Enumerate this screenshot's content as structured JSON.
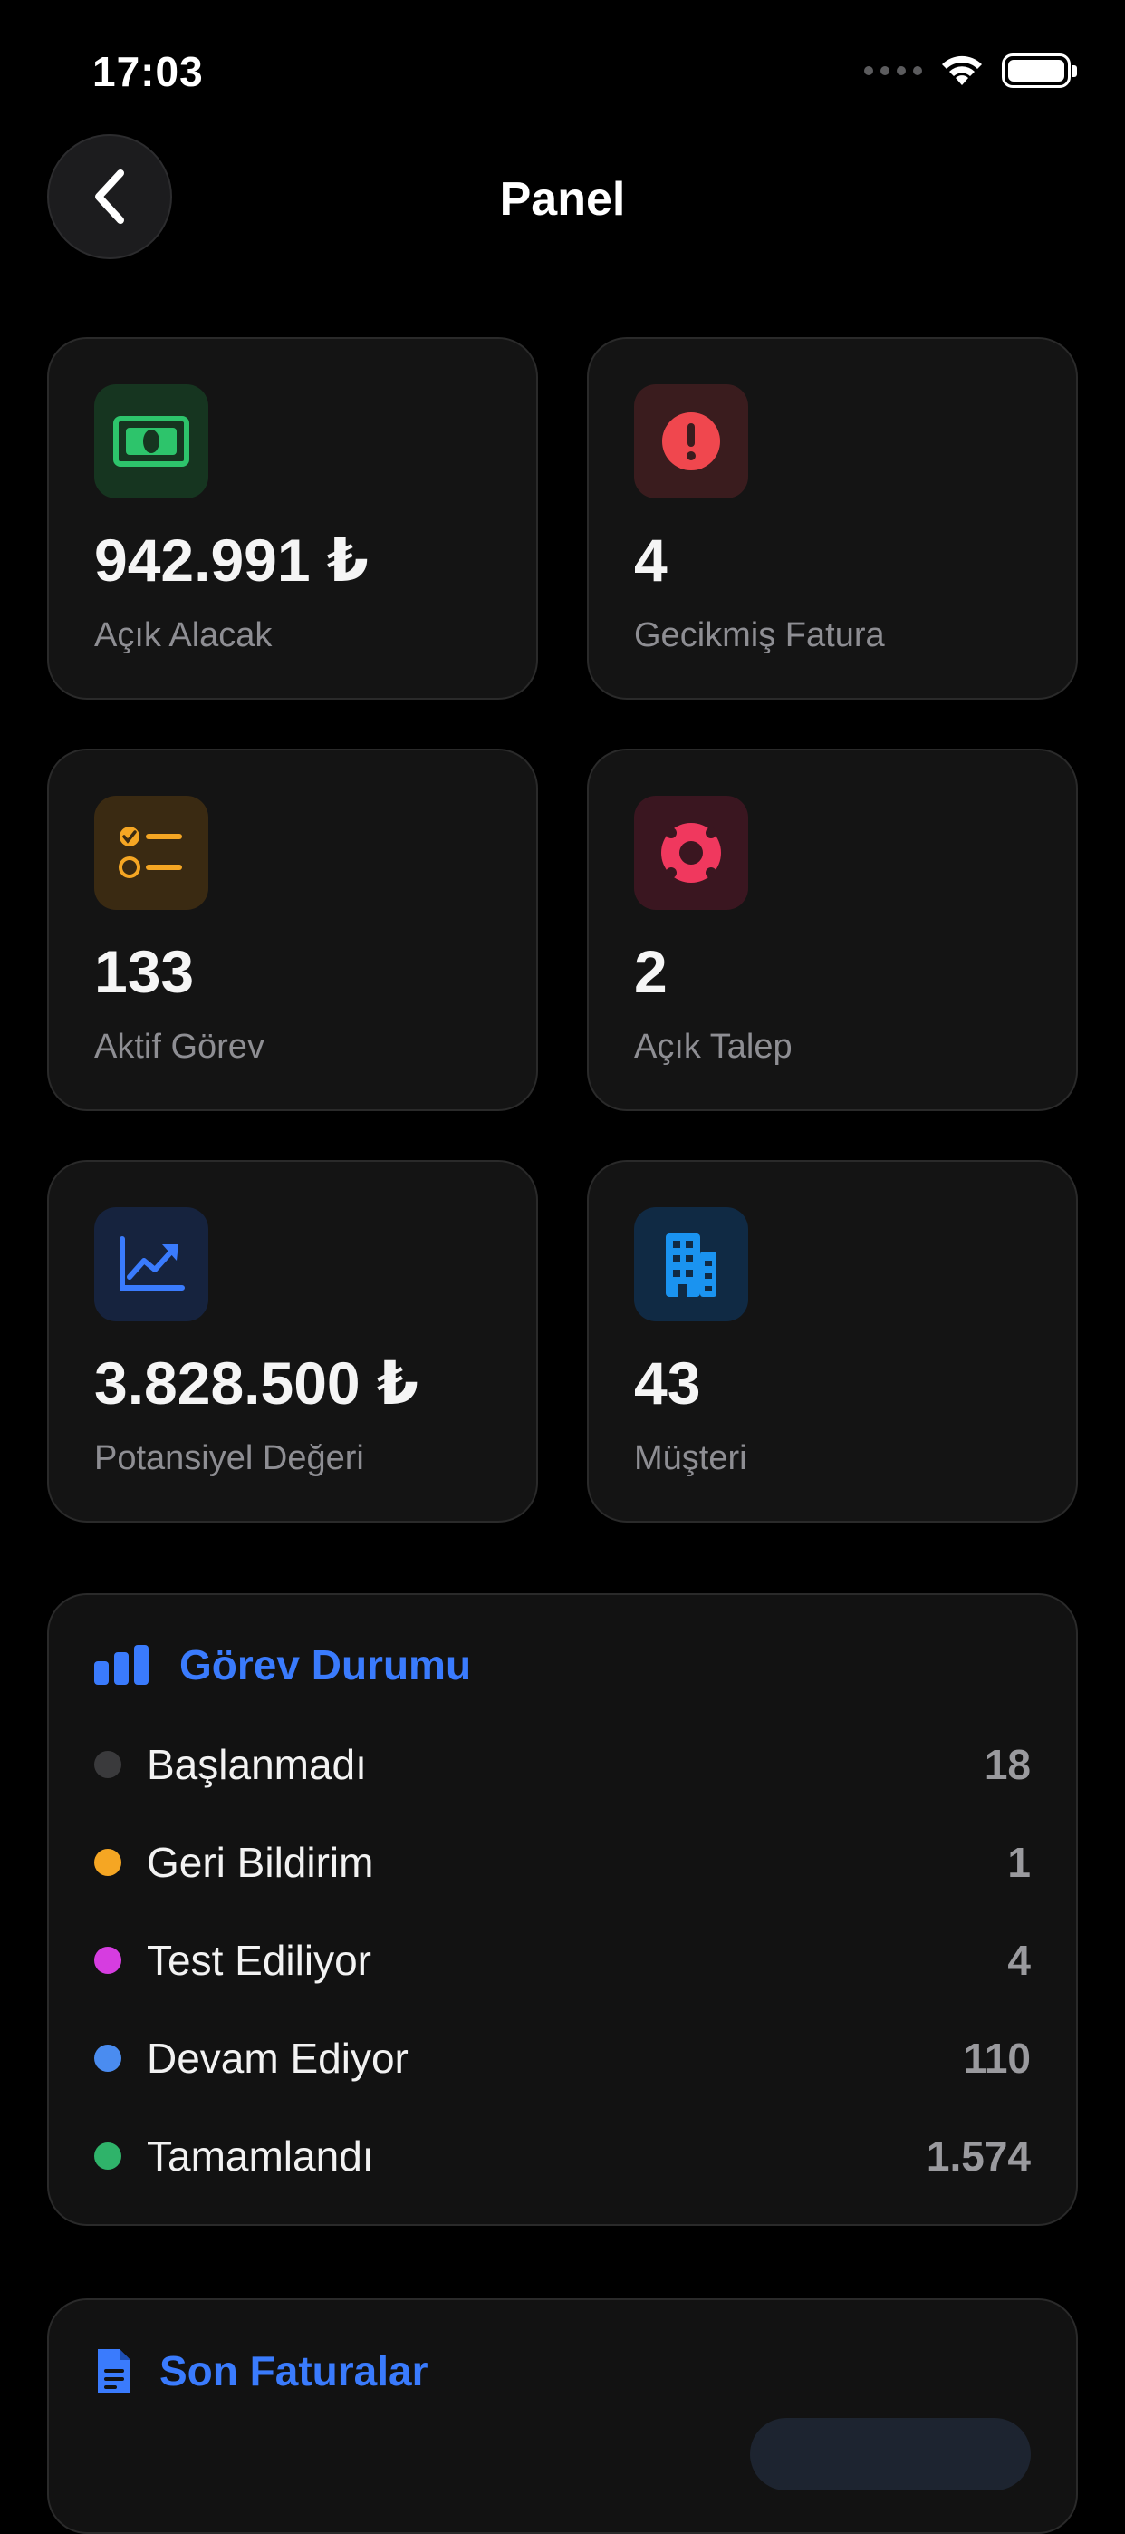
{
  "status_bar": {
    "time": "17:03"
  },
  "nav": {
    "title": "Panel"
  },
  "stats": [
    {
      "value": "942.991 ₺",
      "label": "Açık Alacak",
      "icon": "banknote-icon",
      "icon_bg": "#163520",
      "icon_color": "#2dc46b"
    },
    {
      "value": "4",
      "label": "Gecikmiş Fatura",
      "icon": "alert-circle-icon",
      "icon_bg": "#3a1c1e",
      "icon_color": "#f0474e"
    },
    {
      "value": "133",
      "label": "Aktif Görev",
      "icon": "checklist-icon",
      "icon_bg": "#3a2a12",
      "icon_color": "#f5a623"
    },
    {
      "value": "2",
      "label": "Açık Talep",
      "icon": "lifebuoy-icon",
      "icon_bg": "#3a1620",
      "icon_color": "#f0385e"
    },
    {
      "value": "3.828.500 ₺",
      "label": "Potansiyel Değeri",
      "icon": "trend-chart-icon",
      "icon_bg": "#16233e",
      "icon_color": "#3a7bfd"
    },
    {
      "value": "43",
      "label": "Müşteri",
      "icon": "building-icon",
      "icon_bg": "#102a44",
      "icon_color": "#1a93f0"
    }
  ],
  "task_status": {
    "title": "Görev Durumu",
    "items": [
      {
        "label": "Başlanmadı",
        "count": "18",
        "color": "#3a3a3c"
      },
      {
        "label": "Geri Bildirim",
        "count": "1",
        "color": "#f5a623"
      },
      {
        "label": "Test Ediliyor",
        "count": "4",
        "color": "#d63de0"
      },
      {
        "label": "Devam Ediyor",
        "count": "110",
        "color": "#4a8cf0"
      },
      {
        "label": "Tamamlandı",
        "count": "1.574",
        "color": "#2fb36a"
      }
    ]
  },
  "recent_invoices": {
    "title": "Son Faturalar"
  }
}
